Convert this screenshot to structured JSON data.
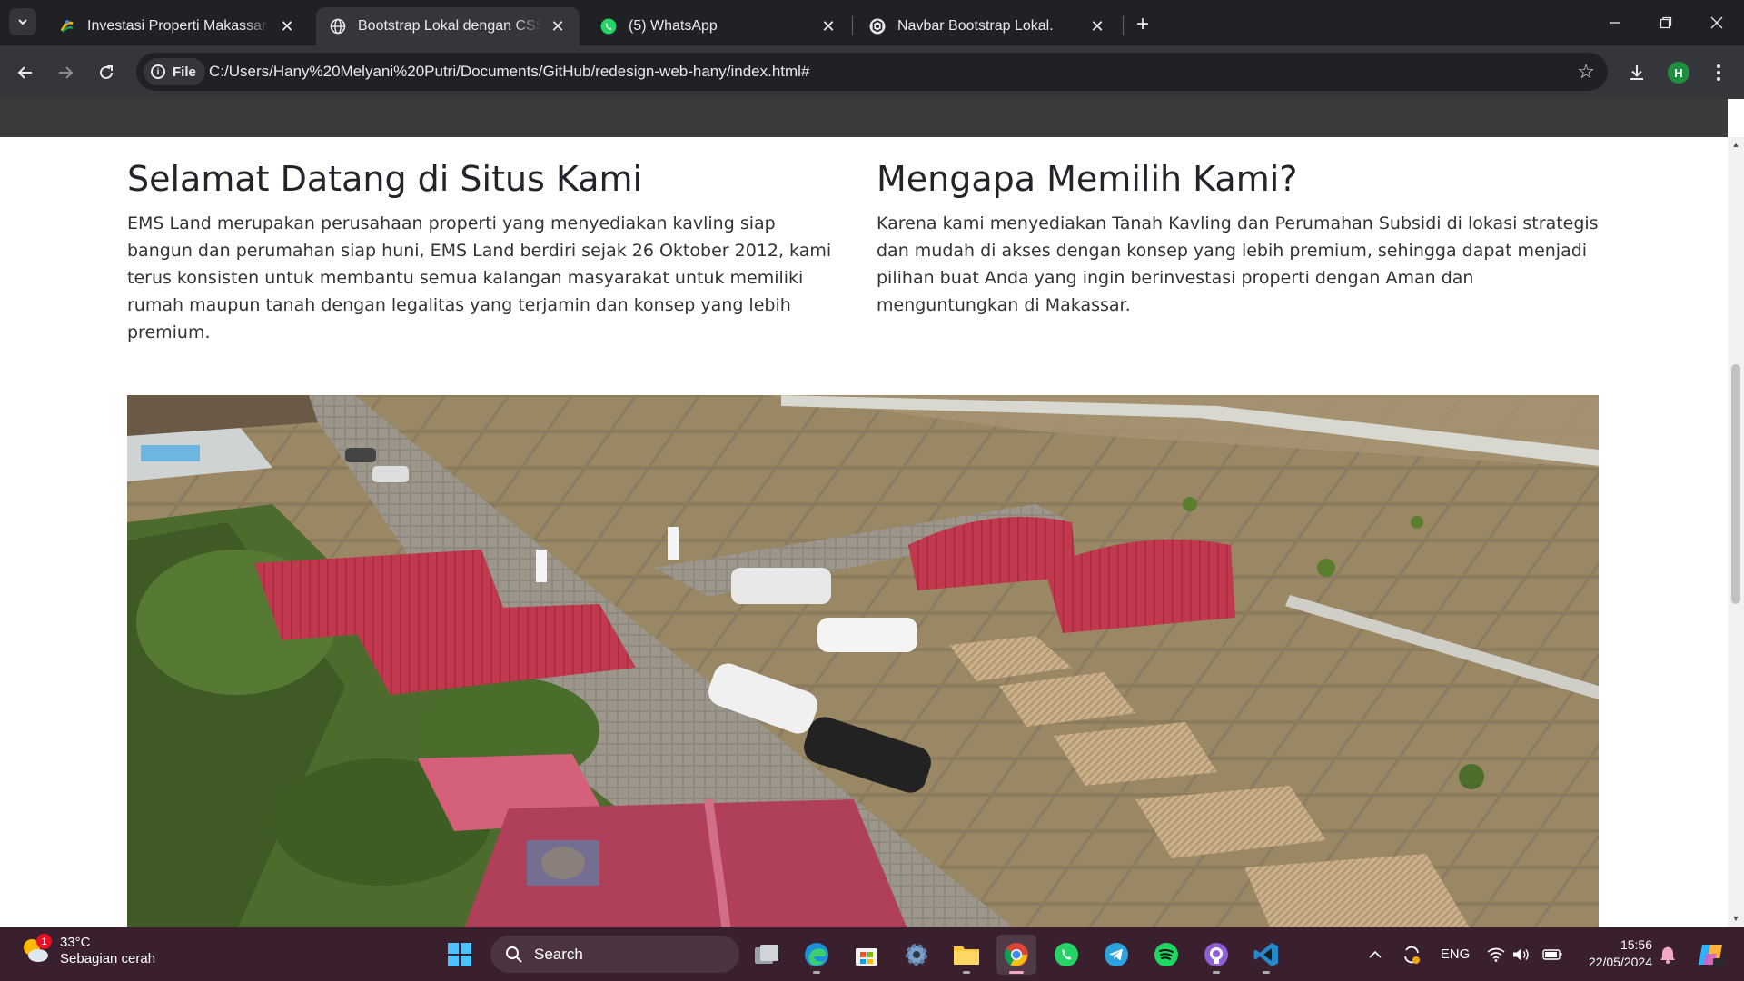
{
  "browser": {
    "tabs": [
      {
        "title": "Investasi Properti Makassar | EMS Land",
        "active": false
      },
      {
        "title": "Bootstrap Lokal dengan CSS dan JS",
        "active": true
      },
      {
        "title": "(5) WhatsApp",
        "active": false
      },
      {
        "title": "Navbar Bootstrap Lokal.",
        "active": false
      }
    ],
    "new_tab": "+",
    "file_chip": "File",
    "url": "C:/Users/Hany%20Melyani%20Putri/Documents/GitHub/redesign-web-hany/index.html#",
    "profile_initial": "H"
  },
  "page": {
    "welcome": {
      "heading": "Selamat Datang di Situs Kami",
      "body": "EMS Land merupakan perusahaan properti yang menyediakan kavling siap bangun dan perumahan siap huni, EMS Land berdiri sejak 26 Oktober 2012, kami terus konsisten untuk membantu semua kalangan masyarakat untuk memiliki rumah maupun tanah dengan legalitas yang terjamin dan konsep yang lebih premium."
    },
    "why_us": {
      "heading": "Mengapa Memilih Kami?",
      "body": "Karena kami menyediakan Tanah Kavling dan Perumahan Subsidi di lokasi strategis dan mudah di akses dengan konsep yang lebih premium, sehingga dapat menjadi pilihan buat Anda yang ingin berinvestasi properti dengan Aman dan menguntungkan di Makassar."
    }
  },
  "taskbar": {
    "weather_temp": "33°C",
    "weather_desc": "Sebagian cerah",
    "weather_badge": "1",
    "search_label": "Search",
    "language": "ENG",
    "time": "15:56",
    "date": "22/05/2024"
  },
  "colors": {
    "tab_strip": "#202124",
    "toolbar": "#35363a",
    "page_nav": "#3b3b3b",
    "taskbar": "#3a1f2e",
    "roof_red": "#b8334a"
  }
}
